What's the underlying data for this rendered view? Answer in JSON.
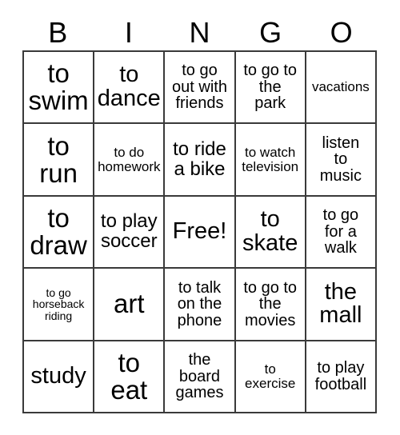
{
  "card": {
    "header_letters": [
      "B",
      "I",
      "N",
      "G",
      "O"
    ],
    "free_space_label": "Free!",
    "rows": [
      [
        {
          "text": "to\nswim",
          "size": "xxl"
        },
        {
          "text": "to\ndance",
          "size": "xl"
        },
        {
          "text": "to go\nout with\nfriends",
          "size": "m"
        },
        {
          "text": "to go to\nthe\npark",
          "size": "m"
        },
        {
          "text": "vacations",
          "size": "s"
        }
      ],
      [
        {
          "text": "to\nrun",
          "size": "xxl"
        },
        {
          "text": "to do\nhomework",
          "size": "s"
        },
        {
          "text": "to ride\na bike",
          "size": "l"
        },
        {
          "text": "to watch\ntelevision",
          "size": "s"
        },
        {
          "text": "listen\nto\nmusic",
          "size": "m"
        }
      ],
      [
        {
          "text": "to\ndraw",
          "size": "xxl"
        },
        {
          "text": "to play\nsoccer",
          "size": "l"
        },
        {
          "text": "Free!",
          "size": "xl"
        },
        {
          "text": "to\nskate",
          "size": "xl"
        },
        {
          "text": "to go\nfor a\nwalk",
          "size": "m"
        }
      ],
      [
        {
          "text": "to go\nhorseback\nriding",
          "size": "xs"
        },
        {
          "text": "art",
          "size": "xxl"
        },
        {
          "text": "to talk\non the\nphone",
          "size": "m"
        },
        {
          "text": "to go to\nthe\nmovies",
          "size": "m"
        },
        {
          "text": "the\nmall",
          "size": "xl"
        }
      ],
      [
        {
          "text": "study",
          "size": "xl"
        },
        {
          "text": "to\neat",
          "size": "xxl"
        },
        {
          "text": "the\nboard\ngames",
          "size": "m"
        },
        {
          "text": "to\nexercise",
          "size": "s"
        },
        {
          "text": "to play\nfootball",
          "size": "m"
        }
      ]
    ]
  },
  "colors": {
    "background": "#ffffff",
    "text": "#000000",
    "grid_line": "#3a3a3a"
  }
}
